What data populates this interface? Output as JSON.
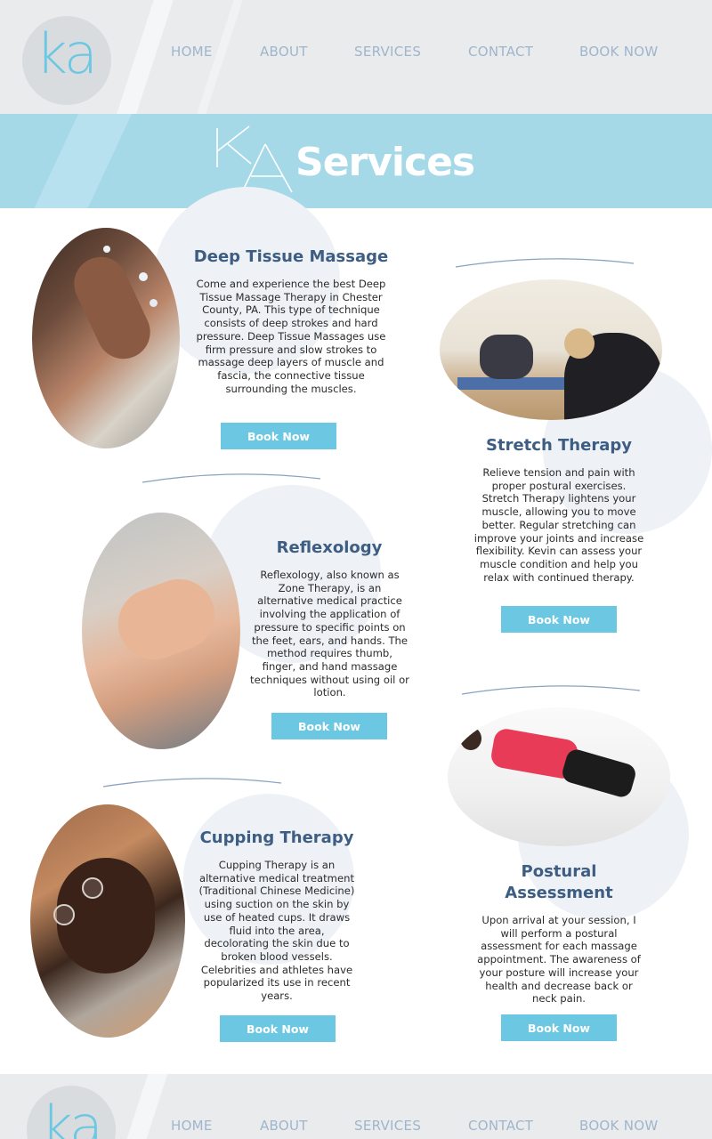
{
  "nav": {
    "logo": "ka",
    "items": [
      "HOME",
      "ABOUT",
      "SERVICES",
      "CONTACT",
      "BOOK NOW"
    ]
  },
  "banner": {
    "logo": "KA",
    "title": "Services"
  },
  "services": [
    {
      "title": "Deep Tissue Massage",
      "description": "Come and experience the best Deep Tissue Massage Therapy in Chester County, PA. This type of technique consists of deep strokes and hard pressure. Deep Tissue Massages use firm pressure and slow strokes to massage deep layers of muscle and fascia, the connective tissue surrounding the muscles.",
      "button": "Book Now"
    },
    {
      "title": "Stretch Therapy",
      "description": "Relieve tension and pain with proper postural exercises. Stretch Therapy lightens your muscle, allowing you to move better. Regular stretching can improve your joints and increase flexibility. Kevin can assess your muscle condition and help you relax with continued therapy.",
      "button": "Book Now"
    },
    {
      "title": "Reflexology",
      "description": "Reflexology, also known as Zone Therapy, is an alternative medical practice involving the application of pressure to specific points on the feet, ears, and hands. The method requires thumb, finger, and hand massage techniques without using oil or lotion.",
      "button": "Book Now"
    },
    {
      "title": "Postural Assessment",
      "description": "Upon arrival at your session, I will perform a postural assessment for each massage appointment. The awareness of your posture will increase your health and decrease back or neck pain.",
      "button": "Book Now"
    },
    {
      "title": "Cupping Therapy",
      "description": "Cupping Therapy is an alternative medical treatment (Traditional Chinese Medicine) using suction on the skin by use of heated cups. It draws fluid into the area, decolorating the skin due to broken blood vessels. Celebrities and athletes have popularized its use in recent years.",
      "button": "Book Now"
    }
  ],
  "colors": {
    "accent": "#6cc8e2",
    "banner": "#a6d9e8",
    "heading": "#3d5d82",
    "nav": "#9fb5cc"
  }
}
